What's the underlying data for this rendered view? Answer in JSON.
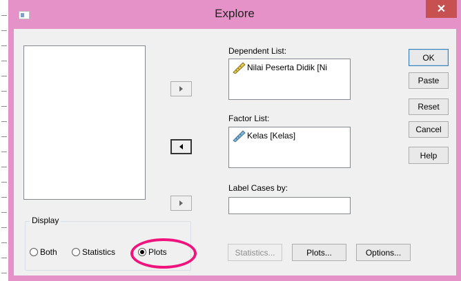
{
  "window": {
    "title": "Explore",
    "close_symbol": "✕"
  },
  "source_list": {
    "items": []
  },
  "dependent_list": {
    "label": "Dependent List:",
    "items": [
      "Nilai Peserta Didik  [Ni"
    ]
  },
  "factor_list": {
    "label": "Factor List:",
    "items": [
      "Kelas  [Kelas]"
    ]
  },
  "label_cases": {
    "label": "Label Cases by:",
    "value": ""
  },
  "side_buttons": {
    "ok": "OK",
    "paste": "Paste",
    "reset": "Reset",
    "cancel": "Cancel",
    "help": "Help"
  },
  "display": {
    "label": "Display",
    "options": [
      "Both",
      "Statistics",
      "Plots"
    ],
    "selected": "Plots"
  },
  "bottom_buttons": {
    "statistics": "Statistics...",
    "plots": "Plots...",
    "options": "Options..."
  },
  "colors": {
    "window_frame": "#e592c8",
    "close_button": "#c75050",
    "highlight_annotation": "#f0137d",
    "dialog_bg": "#f0f0f0"
  },
  "icons": {
    "variable_scale": "ruler-scale-icon",
    "variable_nominal": "ruler-nominal-icon"
  }
}
